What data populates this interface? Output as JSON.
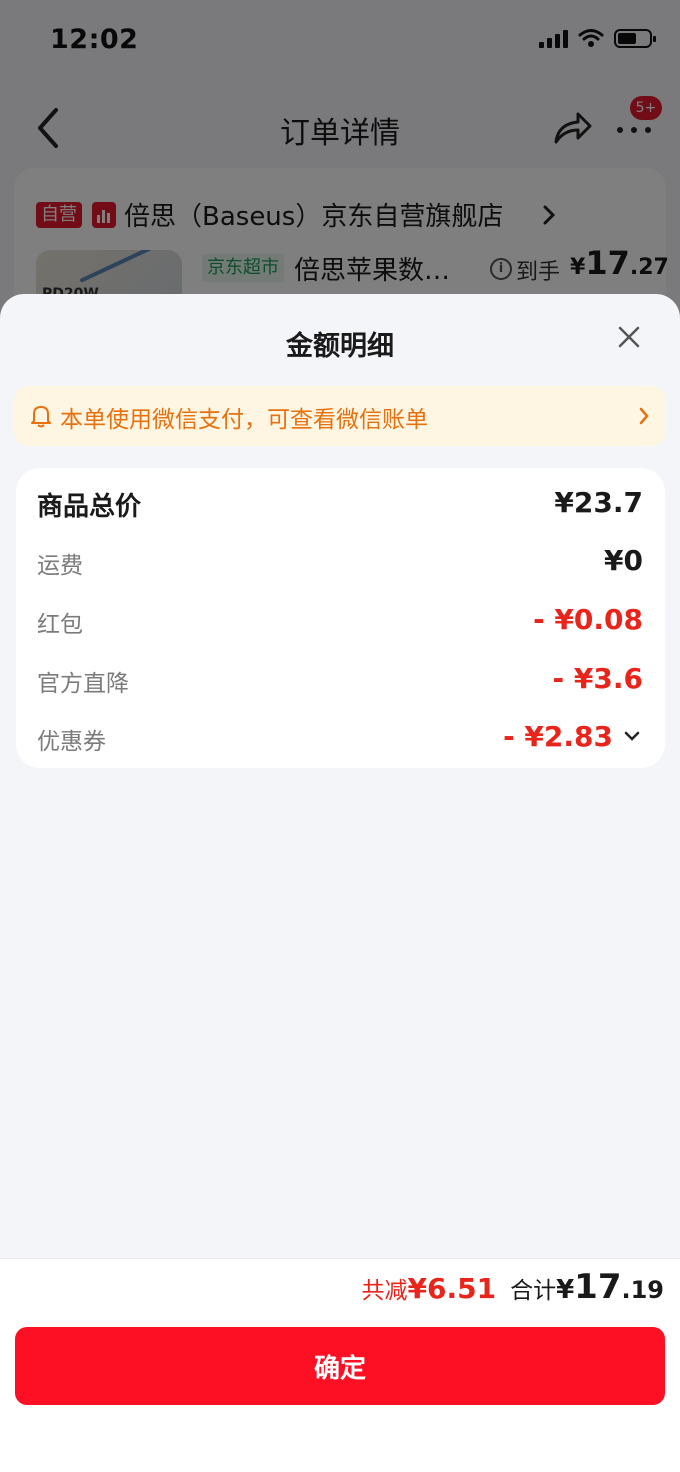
{
  "status_bar": {
    "time": "12:02"
  },
  "nav": {
    "title": "订单详情",
    "badge": "5+"
  },
  "store": {
    "self_tag": "自营",
    "name": "倍思（Baseus）京东自营旗舰店",
    "market_tag": "京东超市",
    "product_name": "倍思苹果数…",
    "product_image_text": "PD20W",
    "arrive_label": "到手",
    "arrive_currency": "¥",
    "arrive_int": "17",
    "arrive_dec": ".27"
  },
  "sheet": {
    "title": "金额明细",
    "wechat_banner": "本单使用微信支付，可查看微信账单",
    "rows": [
      {
        "label": "商品总价",
        "amount": "¥23.7"
      },
      {
        "label": "运费",
        "amount": "¥0"
      },
      {
        "label": "红包",
        "amount": "- ¥0.08"
      },
      {
        "label": "官方直降",
        "amount": "- ¥3.6"
      },
      {
        "label": "优惠券",
        "amount": "- ¥2.83"
      }
    ]
  },
  "footer": {
    "reduce_label": "共减",
    "reduce_value": "¥6.51",
    "total_label": "合计",
    "total_currency": "¥",
    "total_int": "17",
    "total_dec": ".19",
    "confirm_label": "确定"
  },
  "colors": {
    "accent_red": "#fd1023",
    "discount_red": "#e8241b",
    "banner_orange": "#e8710f",
    "banner_bg": "#fef6e2",
    "market_green": "#1a9a57"
  },
  "icons": [
    "back-arrow-icon",
    "share-icon",
    "more-icon",
    "rank-chart-icon",
    "chevron-right-icon",
    "info-icon",
    "close-icon",
    "bell-icon",
    "chevron-down-icon",
    "signal-icon",
    "wifi-icon",
    "battery-icon"
  ]
}
